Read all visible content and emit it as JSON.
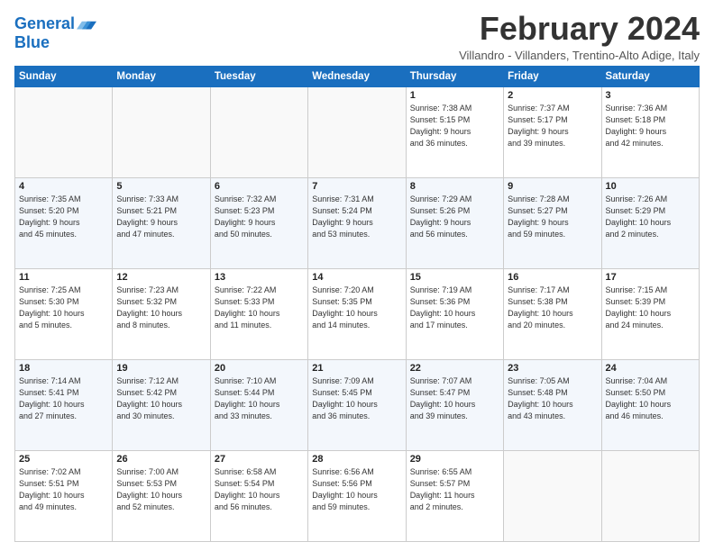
{
  "logo": {
    "line1": "General",
    "line2": "Blue"
  },
  "title": "February 2024",
  "subtitle": "Villandro - Villanders, Trentino-Alto Adige, Italy",
  "days_of_week": [
    "Sunday",
    "Monday",
    "Tuesday",
    "Wednesday",
    "Thursday",
    "Friday",
    "Saturday"
  ],
  "weeks": [
    [
      {
        "day": "",
        "info": ""
      },
      {
        "day": "",
        "info": ""
      },
      {
        "day": "",
        "info": ""
      },
      {
        "day": "",
        "info": ""
      },
      {
        "day": "1",
        "info": "Sunrise: 7:38 AM\nSunset: 5:15 PM\nDaylight: 9 hours\nand 36 minutes."
      },
      {
        "day": "2",
        "info": "Sunrise: 7:37 AM\nSunset: 5:17 PM\nDaylight: 9 hours\nand 39 minutes."
      },
      {
        "day": "3",
        "info": "Sunrise: 7:36 AM\nSunset: 5:18 PM\nDaylight: 9 hours\nand 42 minutes."
      }
    ],
    [
      {
        "day": "4",
        "info": "Sunrise: 7:35 AM\nSunset: 5:20 PM\nDaylight: 9 hours\nand 45 minutes."
      },
      {
        "day": "5",
        "info": "Sunrise: 7:33 AM\nSunset: 5:21 PM\nDaylight: 9 hours\nand 47 minutes."
      },
      {
        "day": "6",
        "info": "Sunrise: 7:32 AM\nSunset: 5:23 PM\nDaylight: 9 hours\nand 50 minutes."
      },
      {
        "day": "7",
        "info": "Sunrise: 7:31 AM\nSunset: 5:24 PM\nDaylight: 9 hours\nand 53 minutes."
      },
      {
        "day": "8",
        "info": "Sunrise: 7:29 AM\nSunset: 5:26 PM\nDaylight: 9 hours\nand 56 minutes."
      },
      {
        "day": "9",
        "info": "Sunrise: 7:28 AM\nSunset: 5:27 PM\nDaylight: 9 hours\nand 59 minutes."
      },
      {
        "day": "10",
        "info": "Sunrise: 7:26 AM\nSunset: 5:29 PM\nDaylight: 10 hours\nand 2 minutes."
      }
    ],
    [
      {
        "day": "11",
        "info": "Sunrise: 7:25 AM\nSunset: 5:30 PM\nDaylight: 10 hours\nand 5 minutes."
      },
      {
        "day": "12",
        "info": "Sunrise: 7:23 AM\nSunset: 5:32 PM\nDaylight: 10 hours\nand 8 minutes."
      },
      {
        "day": "13",
        "info": "Sunrise: 7:22 AM\nSunset: 5:33 PM\nDaylight: 10 hours\nand 11 minutes."
      },
      {
        "day": "14",
        "info": "Sunrise: 7:20 AM\nSunset: 5:35 PM\nDaylight: 10 hours\nand 14 minutes."
      },
      {
        "day": "15",
        "info": "Sunrise: 7:19 AM\nSunset: 5:36 PM\nDaylight: 10 hours\nand 17 minutes."
      },
      {
        "day": "16",
        "info": "Sunrise: 7:17 AM\nSunset: 5:38 PM\nDaylight: 10 hours\nand 20 minutes."
      },
      {
        "day": "17",
        "info": "Sunrise: 7:15 AM\nSunset: 5:39 PM\nDaylight: 10 hours\nand 24 minutes."
      }
    ],
    [
      {
        "day": "18",
        "info": "Sunrise: 7:14 AM\nSunset: 5:41 PM\nDaylight: 10 hours\nand 27 minutes."
      },
      {
        "day": "19",
        "info": "Sunrise: 7:12 AM\nSunset: 5:42 PM\nDaylight: 10 hours\nand 30 minutes."
      },
      {
        "day": "20",
        "info": "Sunrise: 7:10 AM\nSunset: 5:44 PM\nDaylight: 10 hours\nand 33 minutes."
      },
      {
        "day": "21",
        "info": "Sunrise: 7:09 AM\nSunset: 5:45 PM\nDaylight: 10 hours\nand 36 minutes."
      },
      {
        "day": "22",
        "info": "Sunrise: 7:07 AM\nSunset: 5:47 PM\nDaylight: 10 hours\nand 39 minutes."
      },
      {
        "day": "23",
        "info": "Sunrise: 7:05 AM\nSunset: 5:48 PM\nDaylight: 10 hours\nand 43 minutes."
      },
      {
        "day": "24",
        "info": "Sunrise: 7:04 AM\nSunset: 5:50 PM\nDaylight: 10 hours\nand 46 minutes."
      }
    ],
    [
      {
        "day": "25",
        "info": "Sunrise: 7:02 AM\nSunset: 5:51 PM\nDaylight: 10 hours\nand 49 minutes."
      },
      {
        "day": "26",
        "info": "Sunrise: 7:00 AM\nSunset: 5:53 PM\nDaylight: 10 hours\nand 52 minutes."
      },
      {
        "day": "27",
        "info": "Sunrise: 6:58 AM\nSunset: 5:54 PM\nDaylight: 10 hours\nand 56 minutes."
      },
      {
        "day": "28",
        "info": "Sunrise: 6:56 AM\nSunset: 5:56 PM\nDaylight: 10 hours\nand 59 minutes."
      },
      {
        "day": "29",
        "info": "Sunrise: 6:55 AM\nSunset: 5:57 PM\nDaylight: 11 hours\nand 2 minutes."
      },
      {
        "day": "",
        "info": ""
      },
      {
        "day": "",
        "info": ""
      }
    ]
  ]
}
